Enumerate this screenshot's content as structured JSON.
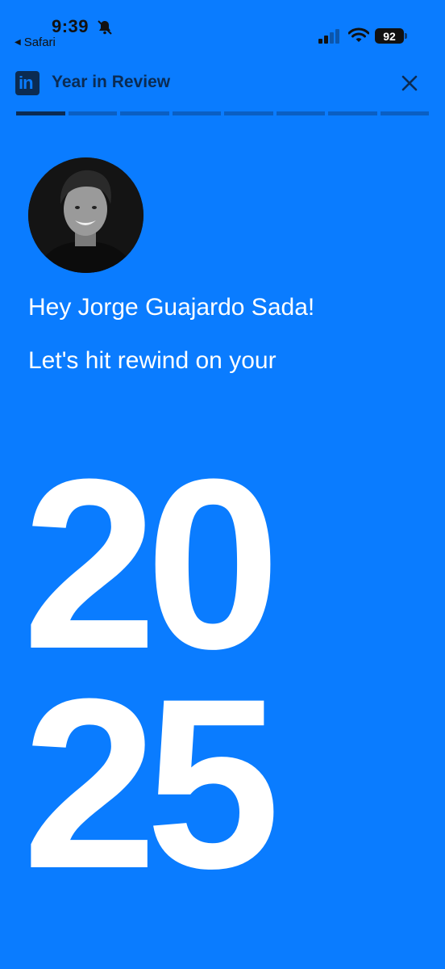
{
  "status_bar": {
    "time": "9:39",
    "back_app": "Safari",
    "battery": "92"
  },
  "header": {
    "logo_text": "in",
    "title": "Year in Review",
    "progress_total": 8,
    "progress_current": 1
  },
  "main": {
    "greeting": "Hey Jorge Guajardo Sada!",
    "subgreeting": "Let's hit rewind on your",
    "year_top": "20",
    "year_bottom": "25"
  },
  "colors": {
    "background": "#0A7CFF",
    "header_ink": "#0B2B52",
    "text": "#FFFFFF"
  }
}
